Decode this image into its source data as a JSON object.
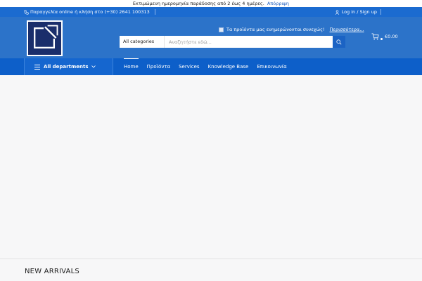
{
  "notice": {
    "text": "Εκτιμώμενη ημερομηνία παράδοσης από 2 έως 4 ημέρες.",
    "dismiss": "Απόρριψη"
  },
  "topbar": {
    "phone_text": "Παραγγελία online ή κλήση στο (+30) 2641 100313",
    "account_text": "Log in / Sign up"
  },
  "promo": {
    "text": "Τα προϊόντα μας ενημερώνονται συνεχώς!",
    "link": "Περισσότερα..."
  },
  "search": {
    "category": "All categories",
    "placeholder": "Αναζητήστε εδώ..."
  },
  "cart": {
    "total": "€0.00"
  },
  "nav": {
    "departments": "All departments",
    "items": [
      {
        "label": "Home"
      },
      {
        "label": "Προϊόντα"
      },
      {
        "label": "Services"
      },
      {
        "label": "Knowledge Base"
      },
      {
        "label": "Επικοινωνία"
      }
    ]
  },
  "sections": {
    "new_arrivals": "NEW ARRIVALS"
  },
  "colors": {
    "topbar": "#1b6bd0",
    "header": "#2c73c9",
    "nav": "#0d5fc9",
    "logo_bg": "#1a2e6b"
  }
}
